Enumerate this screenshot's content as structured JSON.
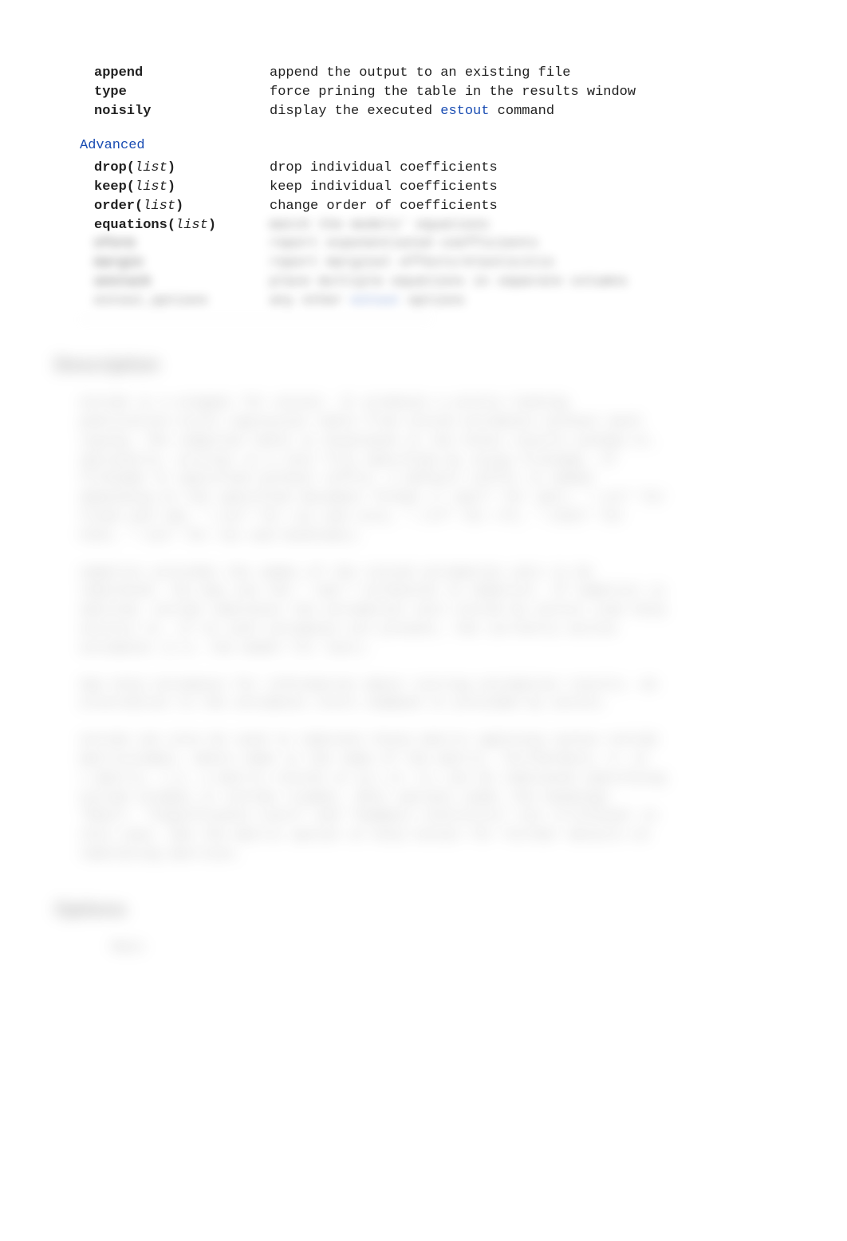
{
  "top_options": [
    {
      "key_bold": "append",
      "key_ital": "",
      "key_close": "",
      "desc_pre": "append the output to an existing file",
      "desc_link": "",
      "desc_post": ""
    },
    {
      "key_bold": "type",
      "key_ital": "",
      "key_close": "",
      "desc_pre": "force prining the table in the results window",
      "desc_link": "",
      "desc_post": ""
    },
    {
      "key_bold": "noisily",
      "key_ital": "",
      "key_close": "",
      "desc_pre": "display the executed ",
      "desc_link": "estout",
      "desc_post": " command"
    }
  ],
  "advanced_head": "Advanced",
  "advanced_options": [
    {
      "key_bold": "drop(",
      "key_ital": "list",
      "key_close": ")",
      "desc": "drop individual coefficients"
    },
    {
      "key_bold": "keep(",
      "key_ital": "list",
      "key_close": ")",
      "desc": "keep individual coefficients"
    },
    {
      "key_bold": "order(",
      "key_ital": "list",
      "key_close": ")",
      "desc": "change order of coefficients"
    },
    {
      "key_bold": "equations(",
      "key_ital": "list",
      "key_close": ")",
      "desc": "match the models' equations"
    }
  ],
  "blurred_options": [
    {
      "key": "eform",
      "desc": "report exponentiated coefficients"
    },
    {
      "key": "margin",
      "desc": "report marginal effects/elasticitis"
    },
    {
      "key": "unstack",
      "desc": "place multiple equations in separate columns"
    },
    {
      "key": "estout_options",
      "desc_pre": "any other ",
      "desc_link": "estout",
      "desc_post": " options"
    }
  ],
  "desc_head": "Description",
  "paragraphs": [
    "esttab is a wrapper for estout. It produces a pretty-looking publication-style regression table from stored estimates without much typing. The compiled table is displayed in the Stata results window or, optionally, written to a text file specified by using filename. If filename is specified without suffix, a default suffix is added depending on the specified document format (\".smcl\" for smcl, \".txt\" for fixed and tab, \".csv\" for csv and scsv, \".rtf\" for rft, \".html\" for html, \".tex\" for tex and booktabs).",
    "namelist provides the names of the stored estimation sets to be tabulated. You may use the * and ? wildcards in namelist. If namelist is omitted, esttab tabulates the estimation sets stored by eststo (see help eststo) or, if no such estimates are present, the currently active estimates (i.e. the model fit last).",
    "See help estimates for information about storing estimation results. An alternative to the estimates store command is provided by eststo.",
    "esttab can also be used to tabulate Stata matrix applying syntax esttab matrix(name), where name is the name of the matrix. Furthermore, e- or r-matrix, i.e. a matrix stored in e() or r() can be tabulated specifying esttab e(name) or esttab r(name). Most options under the headings \"Main\", \"Significance stars\" and \"Summary statistics\" are irrelevant in this case. See the matrix option in help estout for further details on tabulating matrices."
  ],
  "options_head": "Options",
  "options_sub": "Main"
}
